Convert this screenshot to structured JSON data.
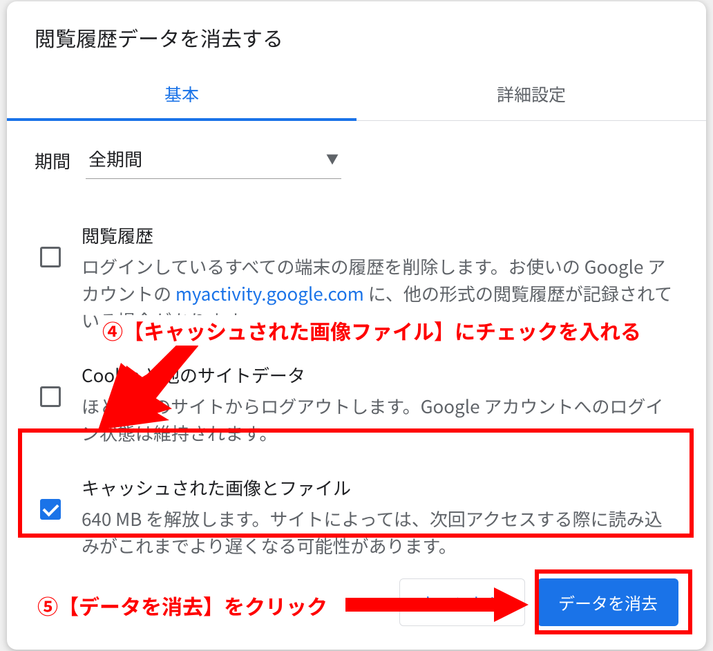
{
  "dialog": {
    "title": "閲覧履歴データを消去する"
  },
  "tabs": {
    "basic": "基本",
    "advanced": "詳細設定"
  },
  "period": {
    "label": "期間",
    "value": "全期間"
  },
  "options": {
    "history": {
      "title": "閲覧履歴",
      "desc_pre": "ログインしているすべての端末の履歴を削除します。お使いの Google アカウントの ",
      "link": "myactivity.google.com",
      "desc_post": " に、他の形式の閲覧履歴が記録されている場合があります。",
      "checked": false
    },
    "cookies": {
      "title": "Cookie と他のサイトデータ",
      "desc": "ほとんどのサイトからログアウトします。Google アカウントへのログイン状態は維持されます。",
      "checked": false
    },
    "cache": {
      "title": "キャッシュされた画像とファイル",
      "desc": "640 MB を解放します。サイトによっては、次回アクセスする際に読み込みがこれまでより遅くなる可能性があります。",
      "checked": true
    }
  },
  "buttons": {
    "cancel": "キャンセル",
    "clear": "データを消去"
  },
  "annotations": {
    "step4": "④【キャッシュされた画像ファイル】にチェックを入れる",
    "step5": "⑤【データを消去】をクリック"
  }
}
